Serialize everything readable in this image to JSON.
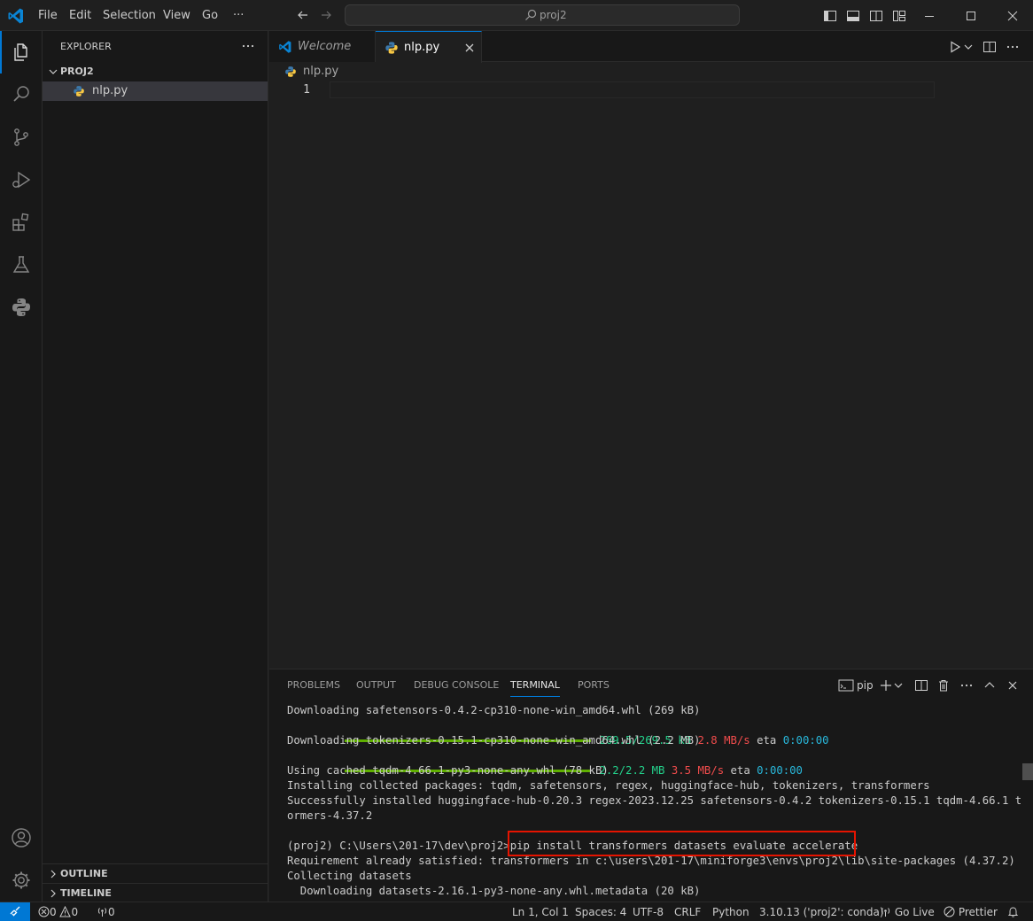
{
  "titlebar": {
    "menus": [
      "File",
      "Edit",
      "Selection",
      "View",
      "Go",
      "···"
    ],
    "search_text": "proj2"
  },
  "sidebar": {
    "title": "EXPLORER",
    "folder": "PROJ2",
    "files": [
      "nlp.py"
    ],
    "outline": "OUTLINE",
    "timeline": "TIMELINE"
  },
  "tabs": [
    {
      "label": "Welcome",
      "active": false
    },
    {
      "label": "nlp.py",
      "active": true
    }
  ],
  "breadcrumb": "nlp.py",
  "editor": {
    "line_numbers": [
      "1"
    ]
  },
  "panel": {
    "tabs": [
      "PROBLEMS",
      "OUTPUT",
      "DEBUG CONSOLE",
      "TERMINAL",
      "PORTS"
    ],
    "active_tab": "TERMINAL",
    "terminal_name": "pip"
  },
  "terminal": {
    "line1": "Downloading safetensors-0.4.2-cp310-none-win_amd64.whl (269 kB)",
    "prog1_size": "269.5/269.5 kB",
    "prog1_speed": "2.8 MB/s",
    "prog1_eta_label": "eta",
    "prog1_eta": "0:00:00",
    "line3": "Downloading tokenizers-0.15.1-cp310-none-win_amd64.whl (2.2 MB)",
    "prog2_size": "2.2/2.2 MB",
    "prog2_speed": "3.5 MB/s",
    "prog2_eta_label": "eta",
    "prog2_eta": "0:00:00",
    "line5": "Using cached tqdm-4.66.1-py3-none-any.whl (78 kB)",
    "line6": "Installing collected packages: tqdm, safetensors, regex, huggingface-hub, tokenizers, transformers",
    "line7": "Successfully installed huggingface-hub-0.20.3 regex-2023.12.25 safetensors-0.4.2 tokenizers-0.15.1 tqdm-4.66.1 transf",
    "line8": "ormers-4.37.2",
    "prompt": "(proj2) C:\\Users\\201-17\\dev\\proj2>",
    "command": "pip install transformers datasets evaluate accelerate",
    "line11": "Requirement already satisfied: transformers in c:\\users\\201-17\\miniforge3\\envs\\proj2\\lib\\site-packages (4.37.2)",
    "line12": "Collecting datasets",
    "line13": "  Downloading datasets-2.16.1-py3-none-any.whl.metadata (20 kB)"
  },
  "statusbar": {
    "errors": "0",
    "warnings": "0",
    "ports": "0",
    "position": "Ln 1, Col 1",
    "spaces": "Spaces: 4",
    "encoding": "UTF-8",
    "eol": "CRLF",
    "language": "Python",
    "interpreter": "3.10.13 ('proj2': conda)",
    "golive": "Go Live",
    "prettier": "Prettier"
  },
  "colors": {
    "accent": "#0078d4",
    "highlight_box": "#e51400",
    "progress_bar": "#5faf00",
    "term_green": "#23d18b",
    "term_red": "#f14c4c",
    "term_cyan": "#29b8db"
  }
}
